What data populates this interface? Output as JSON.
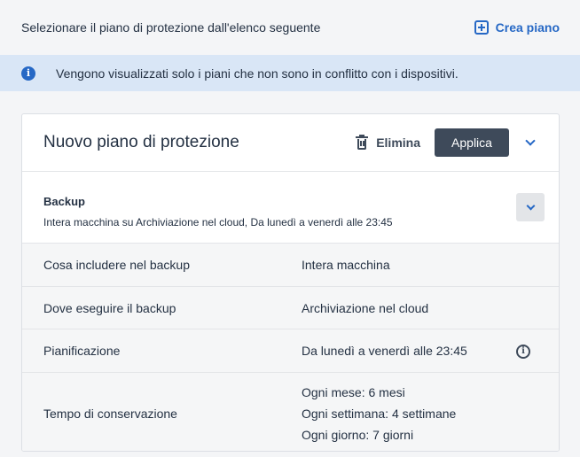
{
  "header": {
    "prompt": "Selezionare il piano di protezione dall'elenco seguente",
    "create_label": "Crea piano"
  },
  "info_banner": {
    "text": "Vengono visualizzati solo i piani che non sono in conflitto con i dispositivi."
  },
  "plan_card": {
    "title": "Nuovo piano di protezione",
    "delete_label": "Elimina",
    "apply_label": "Applica",
    "section": {
      "title": "Backup",
      "summary": "Intera macchina su Archiviazione nel cloud, Da lunedì a venerdì alle 23:45"
    },
    "rows": [
      {
        "label": "Cosa includere nel backup",
        "value": "Intera macchina"
      },
      {
        "label": "Dove eseguire il backup",
        "value": "Archiviazione nel cloud"
      },
      {
        "label": "Pianificazione",
        "value": "Da lunedì a venerdì alle 23:45"
      },
      {
        "label": "Tempo di conservazione",
        "values": [
          "Ogni mese: 6 mesi",
          "Ogni settimana: 4 settimane",
          "Ogni giorno: 7 giorni"
        ]
      }
    ]
  },
  "colors": {
    "accent": "#2668c5",
    "banner_bg": "#d9e6f6",
    "button_dark": "#3e4a5a",
    "page_bg": "#f4f5f7"
  },
  "icons": {
    "create": "plus-square-icon",
    "banner": "info-icon",
    "delete": "trash-icon",
    "expand": "chevron-down-icon",
    "schedule_info": "info-circle-icon"
  }
}
